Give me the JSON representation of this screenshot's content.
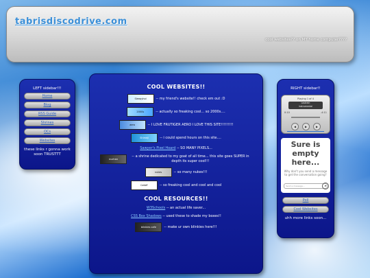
{
  "header": {
    "site_title": "tabrisdiscodrive.com",
    "tagline": "cool websites?? on MY home computer????"
  },
  "left_sidebar": {
    "title": "LEFT sidebar!!!",
    "links": [
      "Home",
      "Blog",
      "RSS Guide",
      "Shrines",
      "OCs",
      "Websites"
    ],
    "note": "these links r gonna work soon TRUSTTT"
  },
  "main": {
    "sites_heading": "COOL WEBSITES!!",
    "sites": [
      {
        "button": "Sleepyhol",
        "text": "-- my friend's website!! check em out :D"
      },
      {
        "button": "2000s",
        "text": "-- actually so freaking cool... so 2000s...."
      },
      {
        "button": "aero",
        "text": "-- I LOVE FRUTIGER AERO I LOVE THIS SITE!!!!!!!!!"
      },
      {
        "button": "Shimeji",
        "text": "-- i could spend hours on this site...."
      },
      {
        "link": "Sawyer's Pixel Hoard",
        "text": "-- SO MANY PIXELS..."
      },
      {
        "button": "nuchan",
        "text": "-- a shrine dedicated to my goat of all time... this site goes SUPER in depth its super cool!!!"
      },
      {
        "button": "nukes",
        "text": "-- so many nukes!!!"
      },
      {
        "button": "Catbff",
        "text": "-- so freaking cool and cool and cool"
      }
    ],
    "resources_heading": "COOL RESOURCES!!",
    "resources": [
      {
        "link": "W3Schools",
        "text": "-- an actual life saver..."
      },
      {
        "link": "CSS Box Shadows",
        "text": "-- used these to shade my boxes!!"
      },
      {
        "button": "blinkies cafe",
        "text": "-- make ur own blinkies here!!!"
      }
    ]
  },
  "right_sidebar": {
    "title": "RIGHT sidebar!!",
    "player": {
      "playing": "Playing 1 of 4",
      "track_title": "Lostrain",
      "track_sub": "instrumental",
      "time_elapsed": "0:10",
      "time_remaining": "-4:11"
    },
    "chat": {
      "headline": "Sure is empty here...",
      "prompt": "Why don't you send a message to get the conversation going?",
      "input_placeholder": "Send a message..."
    },
    "links": [
      "Poll",
      "Cool Websites"
    ],
    "note": "uhh more links soon..."
  },
  "colors": {
    "panel_blue": "#0c168a",
    "link_blue": "#8fd0ff",
    "title_blue": "#3a8fd8"
  }
}
